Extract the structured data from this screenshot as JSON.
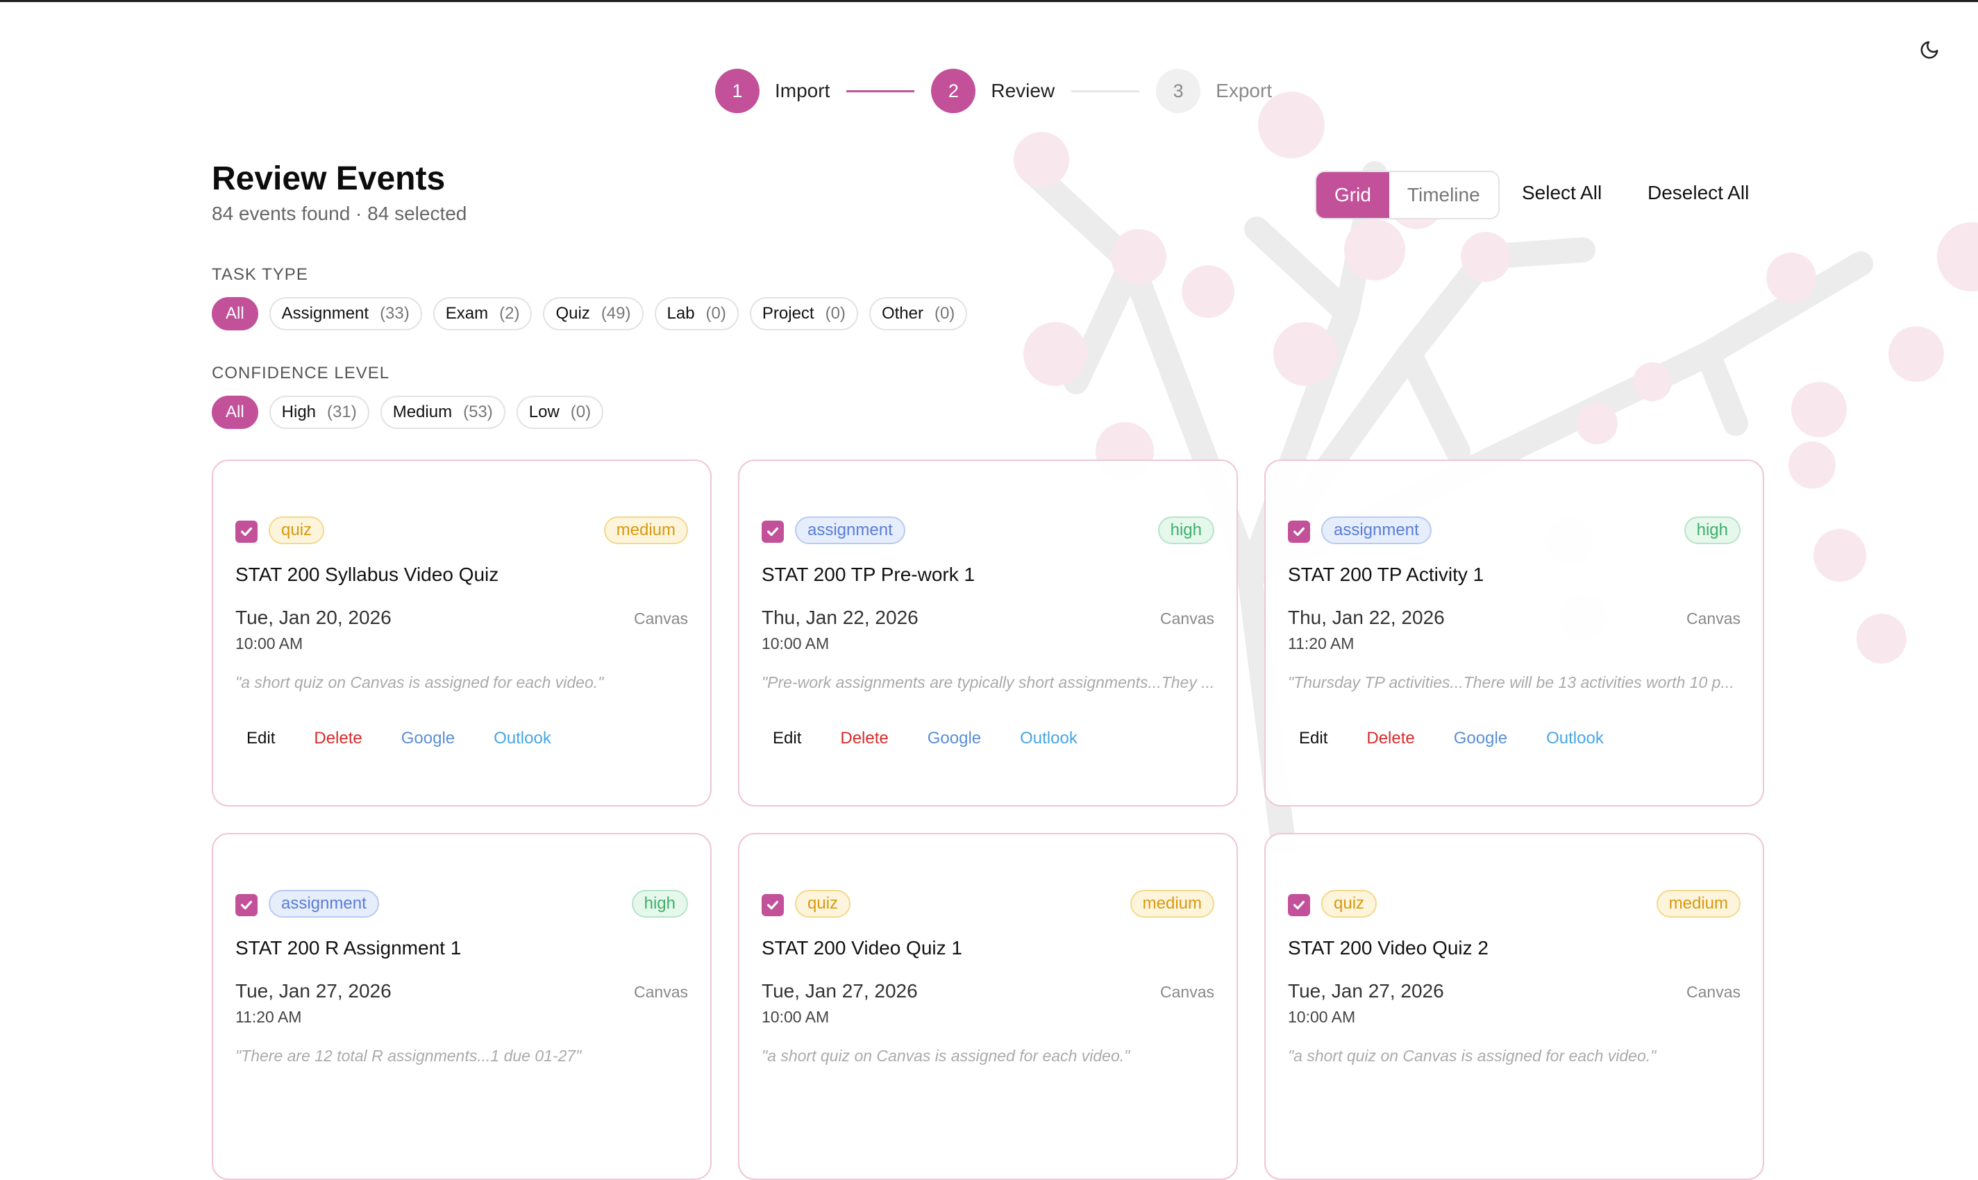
{
  "colors": {
    "accent": "#c2519a",
    "quiz": "#d79a10",
    "assignment": "#5a7ed6",
    "high": "#3db06b",
    "delete": "#d92b2b"
  },
  "stepper": {
    "steps": [
      {
        "number": "1",
        "label": "Import",
        "state": "done"
      },
      {
        "number": "2",
        "label": "Review",
        "state": "active"
      },
      {
        "number": "3",
        "label": "Export",
        "state": "inactive"
      }
    ]
  },
  "theme_toggle_icon": "moon-icon",
  "header": {
    "title": "Review Events",
    "subtitle": "84 events found · 84 selected"
  },
  "view_toggle": {
    "grid": "Grid",
    "timeline": "Timeline",
    "selected": "Grid"
  },
  "actions": {
    "select_all": "Select All",
    "deselect_all": "Deselect All"
  },
  "task_type": {
    "label": "TASK TYPE",
    "chips": [
      {
        "label": "All",
        "count": "",
        "active": true
      },
      {
        "label": "Assignment",
        "count": "(33)"
      },
      {
        "label": "Exam",
        "count": "(2)"
      },
      {
        "label": "Quiz",
        "count": "(49)"
      },
      {
        "label": "Lab",
        "count": "(0)"
      },
      {
        "label": "Project",
        "count": "(0)"
      },
      {
        "label": "Other",
        "count": "(0)"
      }
    ]
  },
  "confidence": {
    "label": "CONFIDENCE LEVEL",
    "chips": [
      {
        "label": "All",
        "count": "",
        "active": true
      },
      {
        "label": "High",
        "count": "(31)"
      },
      {
        "label": "Medium",
        "count": "(53)"
      },
      {
        "label": "Low",
        "count": "(0)"
      }
    ]
  },
  "card_actions": {
    "edit": "Edit",
    "delete": "Delete",
    "google": "Google",
    "outlook": "Outlook"
  },
  "events": [
    {
      "type": "quiz",
      "confidence": "medium",
      "title": "STAT 200 Syllabus Video Quiz",
      "date": "Tue, Jan 20, 2026",
      "time": "10:00 AM",
      "source": "Canvas",
      "quote": "\"a short quiz on Canvas is assigned for each video.\"",
      "checked": true
    },
    {
      "type": "assignment",
      "confidence": "high",
      "title": "STAT 200 TP Pre-work 1",
      "date": "Thu, Jan 22, 2026",
      "time": "10:00 AM",
      "source": "Canvas",
      "quote": "\"Pre-work assignments are typically short assignments...They ...",
      "checked": true
    },
    {
      "type": "assignment",
      "confidence": "high",
      "title": "STAT 200 TP Activity 1",
      "date": "Thu, Jan 22, 2026",
      "time": "11:20 AM",
      "source": "Canvas",
      "quote": "\"Thursday TP activities...There will be 13 activities worth 10 p...",
      "checked": true
    },
    {
      "type": "assignment",
      "confidence": "high",
      "title": "STAT 200 R Assignment 1",
      "date": "Tue, Jan 27, 2026",
      "time": "11:20 AM",
      "source": "Canvas",
      "quote": "\"There are 12 total R assignments...1 due 01-27\"",
      "checked": true
    },
    {
      "type": "quiz",
      "confidence": "medium",
      "title": "STAT 200 Video Quiz 1",
      "date": "Tue, Jan 27, 2026",
      "time": "10:00 AM",
      "source": "Canvas",
      "quote": "\"a short quiz on Canvas is assigned for each video.\"",
      "checked": true
    },
    {
      "type": "quiz",
      "confidence": "medium",
      "title": "STAT 200 Video Quiz 2",
      "date": "Tue, Jan 27, 2026",
      "time": "10:00 AM",
      "source": "Canvas",
      "quote": "\"a short quiz on Canvas is assigned for each video.\"",
      "checked": true
    }
  ]
}
